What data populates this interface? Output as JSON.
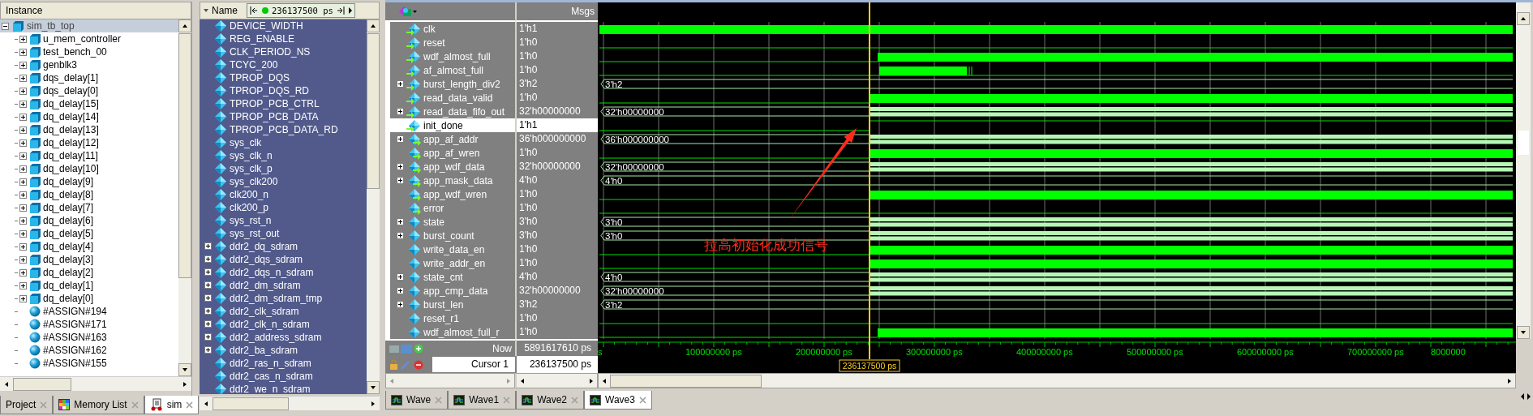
{
  "instance_panel": {
    "header": "Instance",
    "tree": [
      {
        "label": "sim_tb_top",
        "kind": "instance",
        "expanded": true,
        "selected": true,
        "children": [
          {
            "label": "u_mem_controller",
            "kind": "instance",
            "expanded": false,
            "selected": false
          },
          {
            "label": "test_bench_00",
            "kind": "instance",
            "expanded": false,
            "selected": false
          },
          {
            "label": "genblk3",
            "kind": "instance",
            "expanded": false,
            "selected": false
          },
          {
            "label": "dqs_delay[1]",
            "kind": "instance",
            "expanded": false,
            "selected": false
          },
          {
            "label": "dqs_delay[0]",
            "kind": "instance",
            "expanded": false,
            "selected": false
          },
          {
            "label": "dq_delay[15]",
            "kind": "instance",
            "expanded": false,
            "selected": false
          },
          {
            "label": "dq_delay[14]",
            "kind": "instance",
            "expanded": false,
            "selected": false
          },
          {
            "label": "dq_delay[13]",
            "kind": "instance",
            "expanded": false,
            "selected": false
          },
          {
            "label": "dq_delay[12]",
            "kind": "instance",
            "expanded": false,
            "selected": false
          },
          {
            "label": "dq_delay[11]",
            "kind": "instance",
            "expanded": false,
            "selected": false
          },
          {
            "label": "dq_delay[10]",
            "kind": "instance",
            "expanded": false,
            "selected": false
          },
          {
            "label": "dq_delay[9]",
            "kind": "instance",
            "expanded": false,
            "selected": false
          },
          {
            "label": "dq_delay[8]",
            "kind": "instance",
            "expanded": false,
            "selected": false
          },
          {
            "label": "dq_delay[7]",
            "kind": "instance",
            "expanded": false,
            "selected": false
          },
          {
            "label": "dq_delay[6]",
            "kind": "instance",
            "expanded": false,
            "selected": false
          },
          {
            "label": "dq_delay[5]",
            "kind": "instance",
            "expanded": false,
            "selected": false
          },
          {
            "label": "dq_delay[4]",
            "kind": "instance",
            "expanded": false,
            "selected": false
          },
          {
            "label": "dq_delay[3]",
            "kind": "instance",
            "expanded": false,
            "selected": false
          },
          {
            "label": "dq_delay[2]",
            "kind": "instance",
            "expanded": false,
            "selected": false
          },
          {
            "label": "dq_delay[1]",
            "kind": "instance",
            "expanded": false,
            "selected": false
          },
          {
            "label": "dq_delay[0]",
            "kind": "instance",
            "expanded": false,
            "selected": false
          },
          {
            "label": "#ASSIGN#194",
            "kind": "process",
            "selected": false
          },
          {
            "label": "#ASSIGN#171",
            "kind": "process",
            "selected": false
          },
          {
            "label": "#ASSIGN#163",
            "kind": "process",
            "selected": false
          },
          {
            "label": "#ASSIGN#162",
            "kind": "process",
            "selected": false
          },
          {
            "label": "#ASSIGN#155",
            "kind": "process",
            "selected": false
          }
        ]
      }
    ]
  },
  "left_tabs": [
    {
      "label": "Project",
      "kind": "project",
      "selected": false
    },
    {
      "label": "Memory List",
      "kind": "memory",
      "selected": false
    },
    {
      "label": "sim",
      "kind": "sim",
      "selected": true
    }
  ],
  "objects_panel": {
    "header": "Name",
    "time": "236137500 ps",
    "items": [
      {
        "name": "DEVICE_WIDTH"
      },
      {
        "name": "REG_ENABLE"
      },
      {
        "name": "CLK_PERIOD_NS"
      },
      {
        "name": "TCYC_200"
      },
      {
        "name": "TPROP_DQS"
      },
      {
        "name": "TPROP_DQS_RD"
      },
      {
        "name": "TPROP_PCB_CTRL"
      },
      {
        "name": "TPROP_PCB_DATA"
      },
      {
        "name": "TPROP_PCB_DATA_RD"
      },
      {
        "name": "sys_clk"
      },
      {
        "name": "sys_clk_n"
      },
      {
        "name": "sys_clk_p"
      },
      {
        "name": "sys_clk200"
      },
      {
        "name": "clk200_n"
      },
      {
        "name": "clk200_p"
      },
      {
        "name": "sys_rst_n"
      },
      {
        "name": "sys_rst_out"
      },
      {
        "name": "ddr2_dq_sdram",
        "expanded": false
      },
      {
        "name": "ddr2_dqs_sdram",
        "expanded": false
      },
      {
        "name": "ddr2_dqs_n_sdram",
        "expanded": false
      },
      {
        "name": "ddr2_dm_sdram",
        "expanded": false
      },
      {
        "name": "ddr2_dm_sdram_tmp",
        "expanded": false
      },
      {
        "name": "ddr2_clk_sdram",
        "expanded": false
      },
      {
        "name": "ddr2_clk_n_sdram",
        "expanded": false
      },
      {
        "name": "ddr2_address_sdram",
        "expanded": false
      },
      {
        "name": "ddr2_ba_sdram",
        "expanded": false
      },
      {
        "name": "ddr2_ras_n_sdram"
      },
      {
        "name": "ddr2_cas_n_sdram"
      },
      {
        "name": "ddr2_we_n_sdram"
      }
    ]
  },
  "wave_window": {
    "msgs_header": "Msgs",
    "signals": [
      {
        "name": "clk",
        "value": "1'h1",
        "input": true,
        "output": false,
        "selected": false,
        "kind": "clock"
      },
      {
        "name": "reset",
        "value": "1'h0",
        "input": true,
        "output": false,
        "selected": false,
        "kind": "low"
      },
      {
        "name": "wdf_almost_full",
        "value": "1'h0",
        "input": true,
        "output": false,
        "selected": false,
        "kind": "late"
      },
      {
        "name": "af_almost_full",
        "value": "1'h0",
        "input": true,
        "output": false,
        "selected": false,
        "kind": "pulse"
      },
      {
        "name": "burst_length_div2",
        "value": "3'h2",
        "input": true,
        "output": false,
        "expanded": false,
        "selected": false,
        "kind": "bus",
        "trace_label": "3'h2"
      },
      {
        "name": "read_data_valid",
        "value": "1'h0",
        "input": true,
        "output": false,
        "selected": false,
        "kind": "busy"
      },
      {
        "name": "read_data_fifo_out",
        "value": "32'h00000000",
        "input": true,
        "output": false,
        "expanded": false,
        "selected": false,
        "kind": "bus_busy",
        "trace_label": "32'h00000000"
      },
      {
        "name": "init_done",
        "value": "1'h1",
        "input": true,
        "output": false,
        "selected": true,
        "kind": "step"
      },
      {
        "name": "app_af_addr",
        "value": "36'h000000000",
        "input": false,
        "output": true,
        "expanded": false,
        "selected": false,
        "kind": "bus_busy",
        "trace_label": "36'h000000000"
      },
      {
        "name": "app_af_wren",
        "value": "1'h0",
        "input": false,
        "output": true,
        "selected": false,
        "kind": "busy"
      },
      {
        "name": "app_wdf_data",
        "value": "32'h00000000",
        "input": false,
        "output": true,
        "expanded": false,
        "selected": false,
        "kind": "bus_busy",
        "trace_label": "32'h00000000"
      },
      {
        "name": "app_mask_data",
        "value": "4'h0",
        "input": false,
        "output": true,
        "expanded": false,
        "selected": false,
        "kind": "bus",
        "trace_label": "4'h0"
      },
      {
        "name": "app_wdf_wren",
        "value": "1'h0",
        "input": false,
        "output": true,
        "selected": false,
        "kind": "busy"
      },
      {
        "name": "error",
        "value": "1'h0",
        "input": false,
        "output": true,
        "selected": false,
        "kind": "low"
      },
      {
        "name": "state",
        "value": "3'h0",
        "input": false,
        "output": false,
        "expanded": false,
        "selected": false,
        "kind": "bus_busy",
        "trace_label": "3'h0"
      },
      {
        "name": "burst_count",
        "value": "3'h0",
        "input": false,
        "output": false,
        "expanded": false,
        "selected": false,
        "kind": "bus_busy",
        "trace_label": "3'h0"
      },
      {
        "name": "write_data_en",
        "value": "1'h0",
        "input": false,
        "output": false,
        "selected": false,
        "kind": "busy"
      },
      {
        "name": "write_addr_en",
        "value": "1'h0",
        "input": false,
        "output": false,
        "selected": false,
        "kind": "busy"
      },
      {
        "name": "state_cnt",
        "value": "4'h0",
        "input": false,
        "output": false,
        "expanded": false,
        "selected": false,
        "kind": "bus_busy",
        "trace_label": "4'h0"
      },
      {
        "name": "app_cmp_data",
        "value": "32'h00000000",
        "input": false,
        "output": false,
        "expanded": false,
        "selected": false,
        "kind": "bus_busy",
        "trace_label": "32'h00000000"
      },
      {
        "name": "burst_len",
        "value": "3'h2",
        "input": false,
        "output": false,
        "expanded": false,
        "selected": false,
        "kind": "bus",
        "trace_label": "3'h2"
      },
      {
        "name": "reset_r1",
        "value": "1'h0",
        "input": false,
        "output": false,
        "selected": false,
        "kind": "low"
      },
      {
        "name": "wdf_almost_full_r",
        "value": "1'h0",
        "input": false,
        "output": false,
        "selected": false,
        "kind": "late"
      }
    ],
    "now": {
      "label": "Now",
      "value": "5891617610 ps"
    },
    "cursor": {
      "label": "Cursor 1",
      "value": "236137500 ps",
      "marker": "236137500 ps"
    },
    "axis_labels": [
      "s",
      "100000000 ps",
      "200000000 ps",
      "300000000 ps",
      "400000000 ps",
      "500000000 ps",
      "600000000 ps",
      "700000000 ps",
      "8000000"
    ],
    "annotation": "拉高初始化成功信号",
    "tabs": [
      {
        "label": "Wave",
        "selected": false
      },
      {
        "label": "Wave1",
        "selected": false
      },
      {
        "label": "Wave2",
        "selected": false
      },
      {
        "label": "Wave3",
        "selected": true
      }
    ]
  }
}
